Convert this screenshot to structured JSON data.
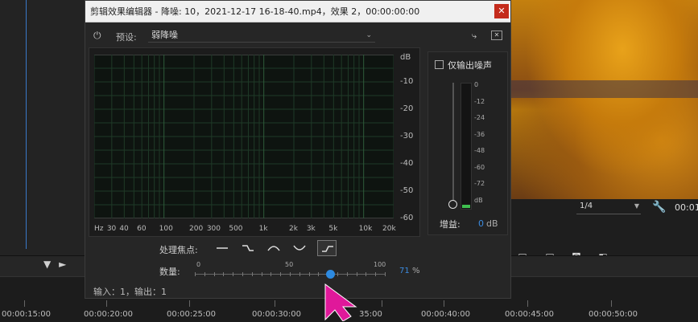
{
  "dialog": {
    "title": "剪辑效果编辑器 - 降噪: 10，2021-12-17 16-18-40.mp4，效果 2，00:00:00:00",
    "close": "✕",
    "preset_label": "预设:",
    "preset_value": "弱降噪",
    "output_noise_only": "仅输出噪声",
    "gain_label": "增益:",
    "gain_value": "0",
    "gain_unit": "dB",
    "focus_label": "处理焦点:",
    "amount_label": "数量:",
    "amount_value": "71",
    "amount_unit": "%",
    "amount_fraction": 0.71,
    "amount_ticks": [
      "0",
      "50",
      "100"
    ],
    "io_text": "输入：1，输出：1",
    "graph": {
      "unit": "dB",
      "y_labels": [
        "-10",
        "-20",
        "-30",
        "-40",
        "-50",
        "-60"
      ],
      "x_labels": [
        "Hz",
        "30",
        "40",
        "60",
        "100",
        "200",
        "300",
        "500",
        "1k",
        "2k",
        "3k",
        "5k",
        "10k",
        "20k"
      ]
    },
    "meter_labels": [
      "0",
      "-12",
      "-24",
      "-36",
      "-48",
      "-60",
      "-72",
      "dB"
    ],
    "focus_selected_index": 4
  },
  "preview": {
    "fraction": "1/4",
    "timecode": "00:01"
  },
  "timeline": {
    "timecodes": [
      "00:00:15:00",
      "00:00:20:00",
      "00:00:25:00",
      "00:00:30:00",
      "35:00",
      "00:00:40:00",
      "00:00:45:00",
      "00:00:50:00"
    ]
  },
  "icons": {
    "power": "power-icon",
    "filter": "filter-icon",
    "wrench": "wrench-icon",
    "camera": "camera-icon"
  },
  "colors": {
    "accent": "#2d8ae0",
    "close": "#c42b1c",
    "pointer": "#e0189a",
    "meter_green": "#3fbf4f"
  }
}
